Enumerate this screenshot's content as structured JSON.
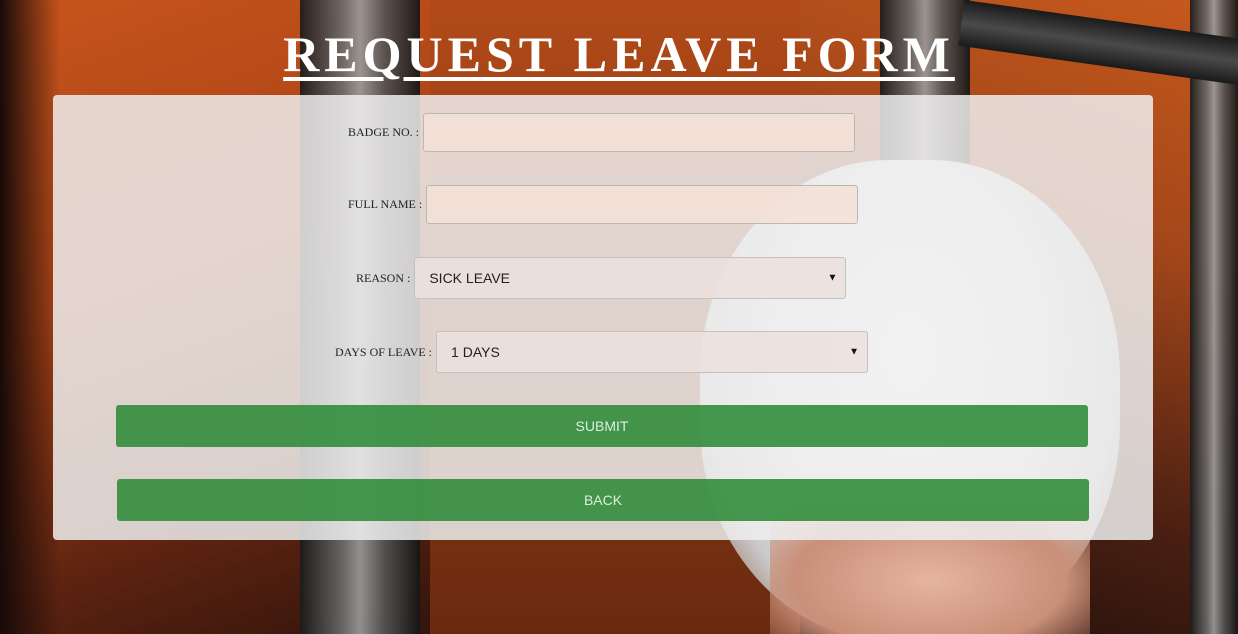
{
  "page": {
    "title": "REQUEST LEAVE FORM"
  },
  "form": {
    "badge_label": "BADGE NO. :",
    "badge_value": "",
    "fullname_label": "FULL NAME :",
    "fullname_value": "",
    "reason_label": "REASON :",
    "reason_selected": "SICK LEAVE",
    "days_label": "DAYS OF LEAVE :",
    "days_selected": "1 DAYS",
    "submit_label": "SUBMIT",
    "back_label": "BACK"
  },
  "colors": {
    "button_green": "#2e8a38",
    "panel": "#eeeeee",
    "title": "#ffffff"
  }
}
